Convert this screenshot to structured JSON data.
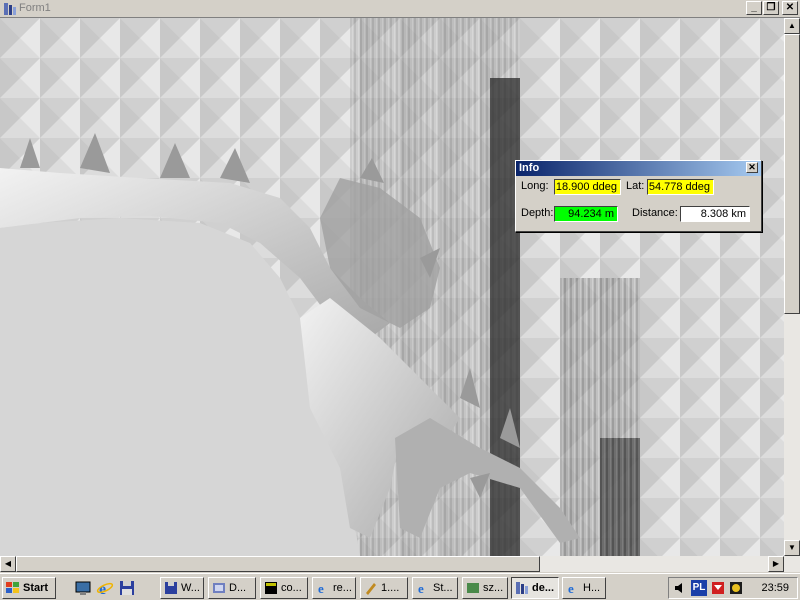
{
  "window": {
    "title": "Form1",
    "minimize_glyph": "_",
    "restore_glyph": "❐",
    "close_glyph": "✕"
  },
  "info_panel": {
    "title": "Info",
    "close_glyph": "✕",
    "long_label": "Long:",
    "long_value": "18.900 ddeg",
    "lat_label": "Lat:",
    "lat_value": "54.778 ddeg",
    "depth_label": "Depth:",
    "depth_value": "94.234 m",
    "distance_label": "Distance:",
    "distance_value": "8.308 km",
    "colors": {
      "long_bg": "#ffff00",
      "lat_bg": "#ffff00",
      "depth_bg": "#00ff00",
      "distance_bg": "#ffffff"
    }
  },
  "scrollbars": {
    "up": "▲",
    "down": "▼",
    "left": "◀",
    "right": "▶"
  },
  "taskbar": {
    "start_label": "Start",
    "quick_launch": [
      "desktop-icon",
      "ie-icon",
      "disk-icon"
    ],
    "tasks": [
      {
        "label": "W...",
        "icon": "disk-icon",
        "active": false
      },
      {
        "label": "D...",
        "icon": "app-icon",
        "active": false
      },
      {
        "label": "co...",
        "icon": "console-icon",
        "active": false
      },
      {
        "label": "re...",
        "icon": "ie-icon",
        "active": false
      },
      {
        "label": "1....",
        "icon": "tool-icon",
        "active": false
      },
      {
        "label": "St...",
        "icon": "ie-icon",
        "active": false
      },
      {
        "label": "sz...",
        "icon": "app-icon",
        "active": false
      },
      {
        "label": "de...",
        "icon": "app-icon",
        "active": true
      },
      {
        "label": "H...",
        "icon": "ie-icon",
        "active": false
      }
    ],
    "tray": {
      "lang": "PL",
      "clock": "23:59"
    }
  }
}
